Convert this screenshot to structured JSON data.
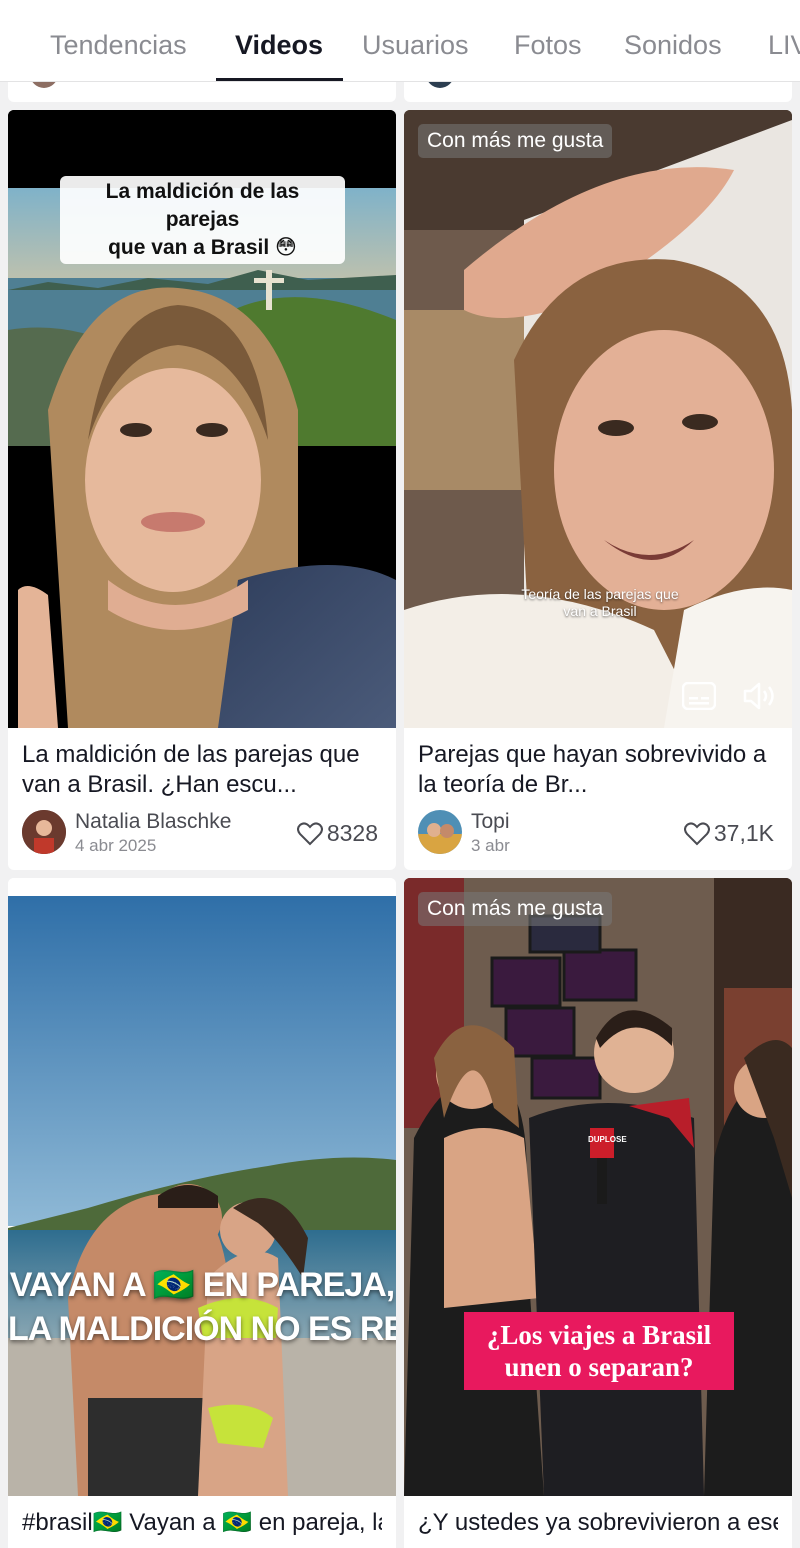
{
  "tabs": [
    {
      "label": "Tendencias"
    },
    {
      "label": "Videos"
    },
    {
      "label": "Usuarios"
    },
    {
      "label": "Fotos"
    },
    {
      "label": "Sonidos"
    },
    {
      "label": "LIVE"
    }
  ],
  "active_tab": "Videos",
  "cards": [
    {
      "overlay_caption": "La maldición de las parejas\nque van a Brasil 😳",
      "badge": "",
      "title": "La maldición de las parejas que van a Brasil. ¿Han escu...",
      "author": "Natalia Blaschke",
      "date": "4 abr 2025",
      "likes": "8328"
    },
    {
      "badge": "Con más me gusta",
      "overlay_caption": "Teoría de las parejas que\nvan a Brasil",
      "title": "Parejas que hayan sobrevivido a la teoría de Br...",
      "author": "Topi",
      "date": "3 abr",
      "likes": "37,1K"
    },
    {
      "badge": "",
      "overlay_caption_line1": "VAYAN A 🇧🇷 EN PAREJA,",
      "overlay_caption_line2": "LA MALDICIÓN NO ES REAL 💘",
      "title": "#brasil🇧🇷 Vayan a 🇧🇷 en pareja, la maldición no es re..."
    },
    {
      "badge": "Con más me gusta",
      "overlay_caption_line1": "¿Los viajes a Brasil",
      "overlay_caption_line2": "unen o separan?",
      "mic_label": "DUPLOSE",
      "title": "¿Y ustedes ya sobrevivieron a ese viaje a brasil como C..."
    }
  ],
  "colors": {
    "accent": "#161823",
    "muted": "#8a8b91",
    "caption_pink": "#e91e63"
  }
}
